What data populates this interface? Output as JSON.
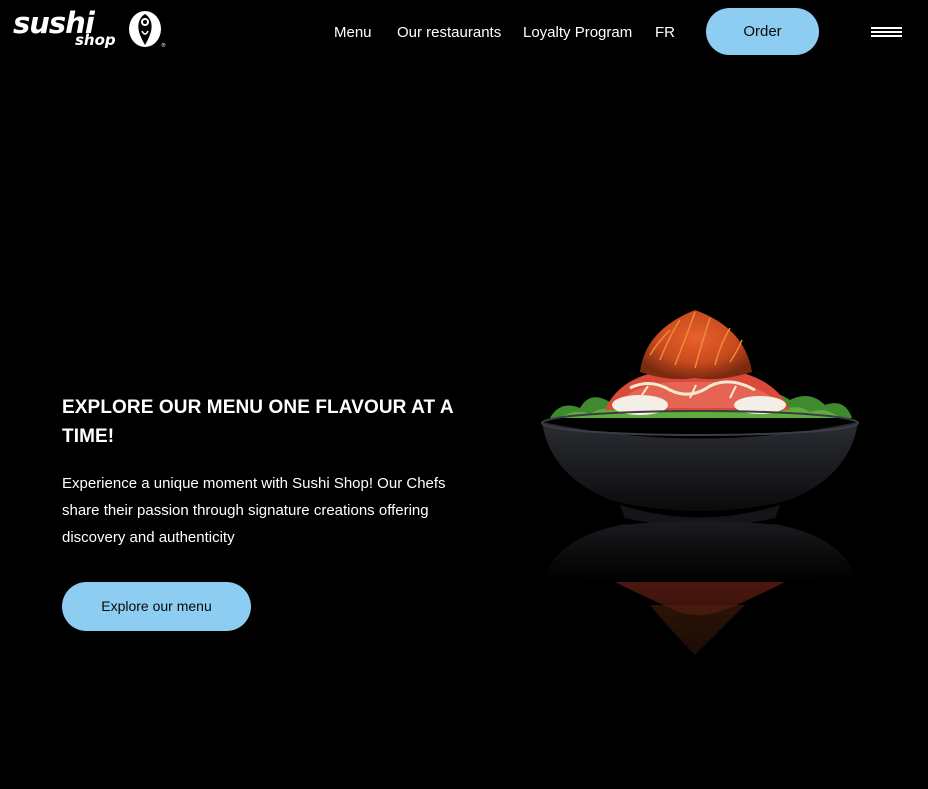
{
  "brand": {
    "logo_top": "sushi",
    "logo_bottom": "shop"
  },
  "nav": {
    "items": [
      {
        "label": "Menu"
      },
      {
        "label": "Our restaurants"
      },
      {
        "label": "Loyalty Program"
      },
      {
        "label": "FR"
      }
    ],
    "order_label": "Order"
  },
  "hero": {
    "title": "EXPLORE OUR MENU ONE FLAVOUR AT A TIME!",
    "description": "Experience a unique moment with Sushi Shop! Our Chefs share their passion through signature creations offering discovery and authenticity",
    "cta_label": "Explore our menu"
  },
  "colors": {
    "background": "#000000",
    "accent": "#8ecdf2",
    "text": "#ffffff"
  },
  "icons": {
    "menu": "hamburger-icon",
    "logo": "sushi-shop-logo-mark"
  }
}
